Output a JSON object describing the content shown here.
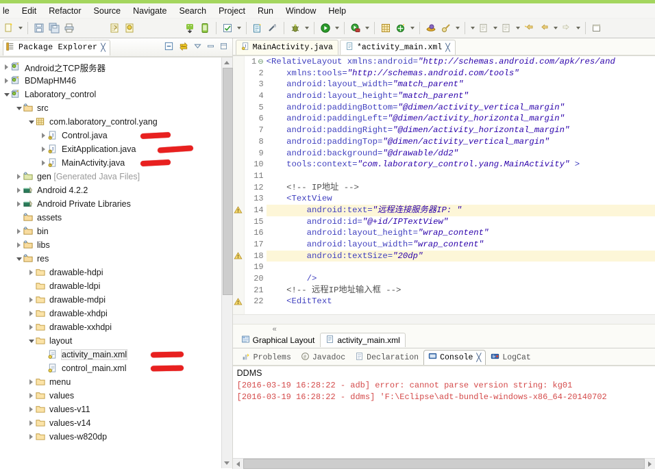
{
  "menubar": {
    "items": [
      {
        "label": "le"
      },
      {
        "label": "Edit"
      },
      {
        "label": "Refactor"
      },
      {
        "label": "Source"
      },
      {
        "label": "Navigate"
      },
      {
        "label": "Search"
      },
      {
        "label": "Project"
      },
      {
        "label": "Run"
      },
      {
        "label": "Window"
      },
      {
        "label": "Help"
      }
    ]
  },
  "toolbar": {
    "icons": [
      "new-wizard-icon",
      "new-dropdown-arrow",
      "save-icon",
      "save-all-icon",
      "print-icon",
      "export-icon",
      "import-icon",
      "android-sdk-manager-icon",
      "android-avd-manager-icon",
      "check-mark-icon",
      "check-dropdown-arrow",
      "new-android-project-icon",
      "disconnect-icon",
      "debug-icon",
      "debug-dropdown-arrow",
      "run-icon",
      "run-dropdown-arrow",
      "run-external-tools-icon",
      "external-dropdown-arrow",
      "new-package-icon",
      "new-class-icon",
      "class-dropdown-arrow",
      "open-perspective-icon",
      "search-icon",
      "search-dropdown-arrow",
      "next-annotation-arrow",
      "next-edit-icon",
      "next-dropdown-arrow",
      "previous-edit-icon",
      "prev-dropdown-arrow",
      "back-star-icon",
      "back-icon",
      "back-dropdown-arrow",
      "forward-icon",
      "forward-dropdown-arrow",
      "new-window-icon"
    ]
  },
  "package_explorer": {
    "title": "Package Explorer",
    "close_glyph": "╳",
    "tools": [
      "collapse-all-icon",
      "link-with-editor-icon",
      "view-menu-icon",
      "minimize-icon",
      "maximize-icon"
    ],
    "tree": [
      {
        "indent": 1,
        "twisty": "collapsed",
        "icon": "android-project-icon",
        "label": "Android之TCP服务器"
      },
      {
        "indent": 1,
        "twisty": "collapsed",
        "icon": "android-project-icon",
        "label": "BDMapHM46"
      },
      {
        "indent": 1,
        "twisty": "expanded",
        "icon": "android-project-icon",
        "label": "Laboratory_control"
      },
      {
        "indent": 2,
        "twisty": "expanded",
        "icon": "source-folder-icon",
        "label": "src"
      },
      {
        "indent": 3,
        "twisty": "expanded",
        "icon": "package-icon",
        "label": "com.laboratory_control.yang"
      },
      {
        "indent": 4,
        "twisty": "collapsed",
        "icon": "java-file-icon",
        "label": "Control.java",
        "marker": "short"
      },
      {
        "indent": 4,
        "twisty": "collapsed",
        "icon": "java-file-icon",
        "label": "ExitApplication.java",
        "marker": "long"
      },
      {
        "indent": 4,
        "twisty": "collapsed",
        "icon": "java-file-icon",
        "label": "MainActivity.java",
        "marker": "short"
      },
      {
        "indent": 2,
        "twisty": "collapsed",
        "icon": "gen-folder-icon",
        "label": "gen ",
        "dim": "[Generated Java Files]"
      },
      {
        "indent": 2,
        "twisty": "collapsed",
        "icon": "library-icon",
        "label": "Android 4.2.2"
      },
      {
        "indent": 2,
        "twisty": "collapsed",
        "icon": "library-icon",
        "label": "Android Private Libraries"
      },
      {
        "indent": 2,
        "twisty": "none",
        "icon": "source-folder-icon",
        "label": "assets"
      },
      {
        "indent": 2,
        "twisty": "collapsed",
        "icon": "source-folder-icon",
        "label": "bin"
      },
      {
        "indent": 2,
        "twisty": "collapsed",
        "icon": "source-folder-icon",
        "label": "libs"
      },
      {
        "indent": 2,
        "twisty": "expanded",
        "icon": "source-folder-icon",
        "label": "res"
      },
      {
        "indent": 3,
        "twisty": "collapsed",
        "icon": "folder-icon",
        "label": "drawable-hdpi"
      },
      {
        "indent": 3,
        "twisty": "none",
        "icon": "folder-icon",
        "label": "drawable-ldpi"
      },
      {
        "indent": 3,
        "twisty": "collapsed",
        "icon": "folder-icon",
        "label": "drawable-mdpi"
      },
      {
        "indent": 3,
        "twisty": "collapsed",
        "icon": "folder-icon",
        "label": "drawable-xhdpi"
      },
      {
        "indent": 3,
        "twisty": "collapsed",
        "icon": "folder-icon",
        "label": "drawable-xxhdpi"
      },
      {
        "indent": 3,
        "twisty": "expanded",
        "icon": "folder-icon",
        "label": "layout"
      },
      {
        "indent": 4,
        "twisty": "none",
        "icon": "xml-file-icon",
        "label": "activity_main.xml",
        "marker": "short",
        "selected": true
      },
      {
        "indent": 4,
        "twisty": "none",
        "icon": "xml-file-icon",
        "label": "control_main.xml",
        "marker": "short"
      },
      {
        "indent": 3,
        "twisty": "collapsed",
        "icon": "folder-icon",
        "label": "menu"
      },
      {
        "indent": 3,
        "twisty": "collapsed",
        "icon": "folder-icon",
        "label": "values"
      },
      {
        "indent": 3,
        "twisty": "collapsed",
        "icon": "folder-icon",
        "label": "values-v11"
      },
      {
        "indent": 3,
        "twisty": "collapsed",
        "icon": "folder-icon",
        "label": "values-v14"
      },
      {
        "indent": 3,
        "twisty": "collapsed",
        "icon": "folder-icon",
        "label": "values-w820dp"
      }
    ]
  },
  "editor": {
    "tabs": [
      {
        "label": "MainActivity.java",
        "icon": "java-file-icon",
        "active": false,
        "closable": false
      },
      {
        "label": "*activity_main.xml",
        "icon": "xml-file-icon",
        "active": true,
        "closable": true,
        "close_glyph": "╳"
      }
    ],
    "collapse_glyph": "«",
    "sub_tabs": [
      {
        "label": "Graphical Layout",
        "icon": "graphical-layout-icon",
        "active": false
      },
      {
        "label": "activity_main.xml",
        "icon": "xml-source-icon",
        "active": true
      }
    ],
    "lines": [
      {
        "n": "1",
        "fold": true,
        "warn": false,
        "tokens": [
          {
            "t": "<RelativeLayout ",
            "c": "k"
          },
          {
            "t": "xmlns:android=",
            "c": "k"
          },
          {
            "t": "\"http://schemas.android.com/apk/res/and",
            "c": "s"
          }
        ]
      },
      {
        "n": "2",
        "warn": false,
        "tokens": [
          {
            "t": "    xmlns:tools=",
            "c": "k"
          },
          {
            "t": "\"http://schemas.android.com/tools\"",
            "c": "s"
          }
        ]
      },
      {
        "n": "3",
        "warn": false,
        "tokens": [
          {
            "t": "    android:layout_width=",
            "c": "k"
          },
          {
            "t": "\"match_parent\"",
            "c": "s"
          }
        ]
      },
      {
        "n": "4",
        "warn": false,
        "tokens": [
          {
            "t": "    android:layout_height=",
            "c": "k"
          },
          {
            "t": "\"match_parent\"",
            "c": "s"
          }
        ]
      },
      {
        "n": "5",
        "warn": false,
        "tokens": [
          {
            "t": "    android:paddingBottom=",
            "c": "k"
          },
          {
            "t": "\"@dimen/activity_vertical_margin\"",
            "c": "s"
          }
        ]
      },
      {
        "n": "6",
        "warn": false,
        "tokens": [
          {
            "t": "    android:paddingLeft=",
            "c": "k"
          },
          {
            "t": "\"@dimen/activity_horizontal_margin\"",
            "c": "s"
          }
        ]
      },
      {
        "n": "7",
        "warn": false,
        "tokens": [
          {
            "t": "    android:paddingRight=",
            "c": "k"
          },
          {
            "t": "\"@dimen/activity_horizontal_margin\"",
            "c": "s"
          }
        ]
      },
      {
        "n": "8",
        "warn": false,
        "tokens": [
          {
            "t": "    android:paddingTop=",
            "c": "k"
          },
          {
            "t": "\"@dimen/activity_vertical_margin\"",
            "c": "s"
          }
        ]
      },
      {
        "n": "9",
        "warn": false,
        "tokens": [
          {
            "t": "    android:background=",
            "c": "k"
          },
          {
            "t": "\"@drawable/dd2\"",
            "c": "s"
          }
        ]
      },
      {
        "n": "10",
        "warn": false,
        "tokens": [
          {
            "t": "    tools:context=",
            "c": "k"
          },
          {
            "t": "\"com.laboratory_control.yang.MainActivity\"",
            "c": "s"
          },
          {
            "t": " >",
            "c": "k"
          }
        ]
      },
      {
        "n": "11",
        "warn": false,
        "tokens": []
      },
      {
        "n": "12",
        "warn": false,
        "tokens": [
          {
            "t": "    <!-- IP地址 -->",
            "c": "cm2"
          }
        ]
      },
      {
        "n": "13",
        "warn": false,
        "tokens": [
          {
            "t": "    <TextView",
            "c": "k"
          }
        ]
      },
      {
        "n": "14",
        "warn": true,
        "hl": true,
        "tokens": [
          {
            "t": "        android:text=",
            "c": "k"
          },
          {
            "t": "\"远程连接服务器IP: \"",
            "c": "s"
          }
        ]
      },
      {
        "n": "15",
        "warn": false,
        "tokens": [
          {
            "t": "        android:id=",
            "c": "k"
          },
          {
            "t": "\"@+id/IPTextView\"",
            "c": "s"
          }
        ]
      },
      {
        "n": "16",
        "warn": false,
        "tokens": [
          {
            "t": "        android:layout_height=",
            "c": "k"
          },
          {
            "t": "\"wrap_content\"",
            "c": "s"
          }
        ]
      },
      {
        "n": "17",
        "warn": false,
        "tokens": [
          {
            "t": "        android:layout_width=",
            "c": "k"
          },
          {
            "t": "\"wrap_content\"",
            "c": "s"
          }
        ]
      },
      {
        "n": "18",
        "warn": true,
        "hl": true,
        "tokens": [
          {
            "t": "        android:textSize=",
            "c": "k"
          },
          {
            "t": "\"20dp\"",
            "c": "s"
          }
        ]
      },
      {
        "n": "19",
        "warn": false,
        "tokens": []
      },
      {
        "n": "20",
        "warn": false,
        "tokens": [
          {
            "t": "        />",
            "c": "k"
          }
        ]
      },
      {
        "n": "21",
        "warn": false,
        "tokens": [
          {
            "t": "    <!-- 远程IP地址输入框 -->",
            "c": "cm2"
          }
        ]
      },
      {
        "n": "22",
        "warn": true,
        "tokens": [
          {
            "t": "    <EditText",
            "c": "k"
          }
        ]
      }
    ]
  },
  "console": {
    "tabs": [
      {
        "label": "Problems",
        "icon": "problems-icon",
        "active": false
      },
      {
        "label": "Javadoc",
        "icon": "javadoc-icon",
        "active": false
      },
      {
        "label": "Declaration",
        "icon": "declaration-icon",
        "active": false
      },
      {
        "label": "Console",
        "icon": "console-icon",
        "active": true,
        "close_glyph": "╳"
      },
      {
        "label": "LogCat",
        "icon": "logcat-icon",
        "active": false
      }
    ],
    "title": "DDMS",
    "lines": [
      "[2016-03-19 16:28:22 - adb] error: cannot parse version string: kg01",
      "[2016-03-19 16:28:22 - ddms] 'F:\\Eclipse\\adt-bundle-windows-x86_64-20140702"
    ]
  },
  "colors": {
    "accent_green": "#a4d65e",
    "marker_red": "#e8201f",
    "console_error": "#d44a4a",
    "string_blue": "#2a00aa",
    "tag_blue": "#3f3fbf"
  }
}
